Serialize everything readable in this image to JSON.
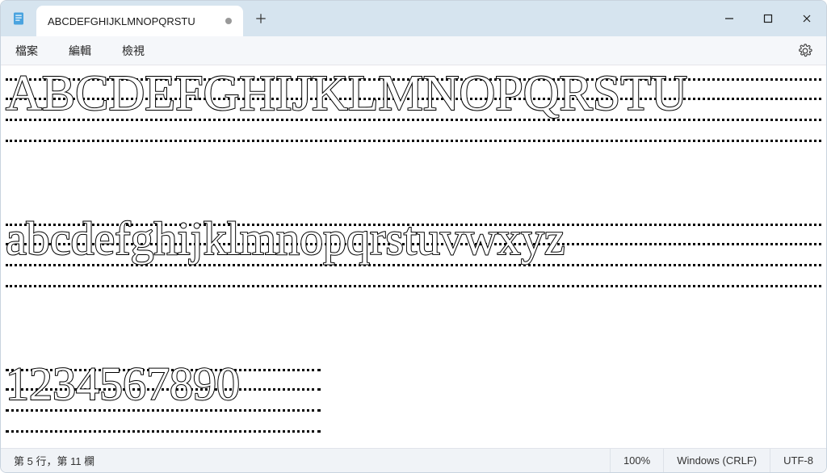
{
  "tab": {
    "title": "ABCDEFGHIJKLMNOPQRSTU"
  },
  "menu": {
    "file": "檔案",
    "edit": "編輯",
    "view": "檢視"
  },
  "content": {
    "line1": "ABCDEFGHIJKLMNOPQRSTU",
    "line2": "abcdefghijklmnopqrstuvwxyz",
    "line3": "1234567890"
  },
  "status": {
    "position": "第 5 行，第 11 欄",
    "zoom": "100%",
    "lineEnding": "Windows (CRLF)",
    "encoding": "UTF-8"
  }
}
